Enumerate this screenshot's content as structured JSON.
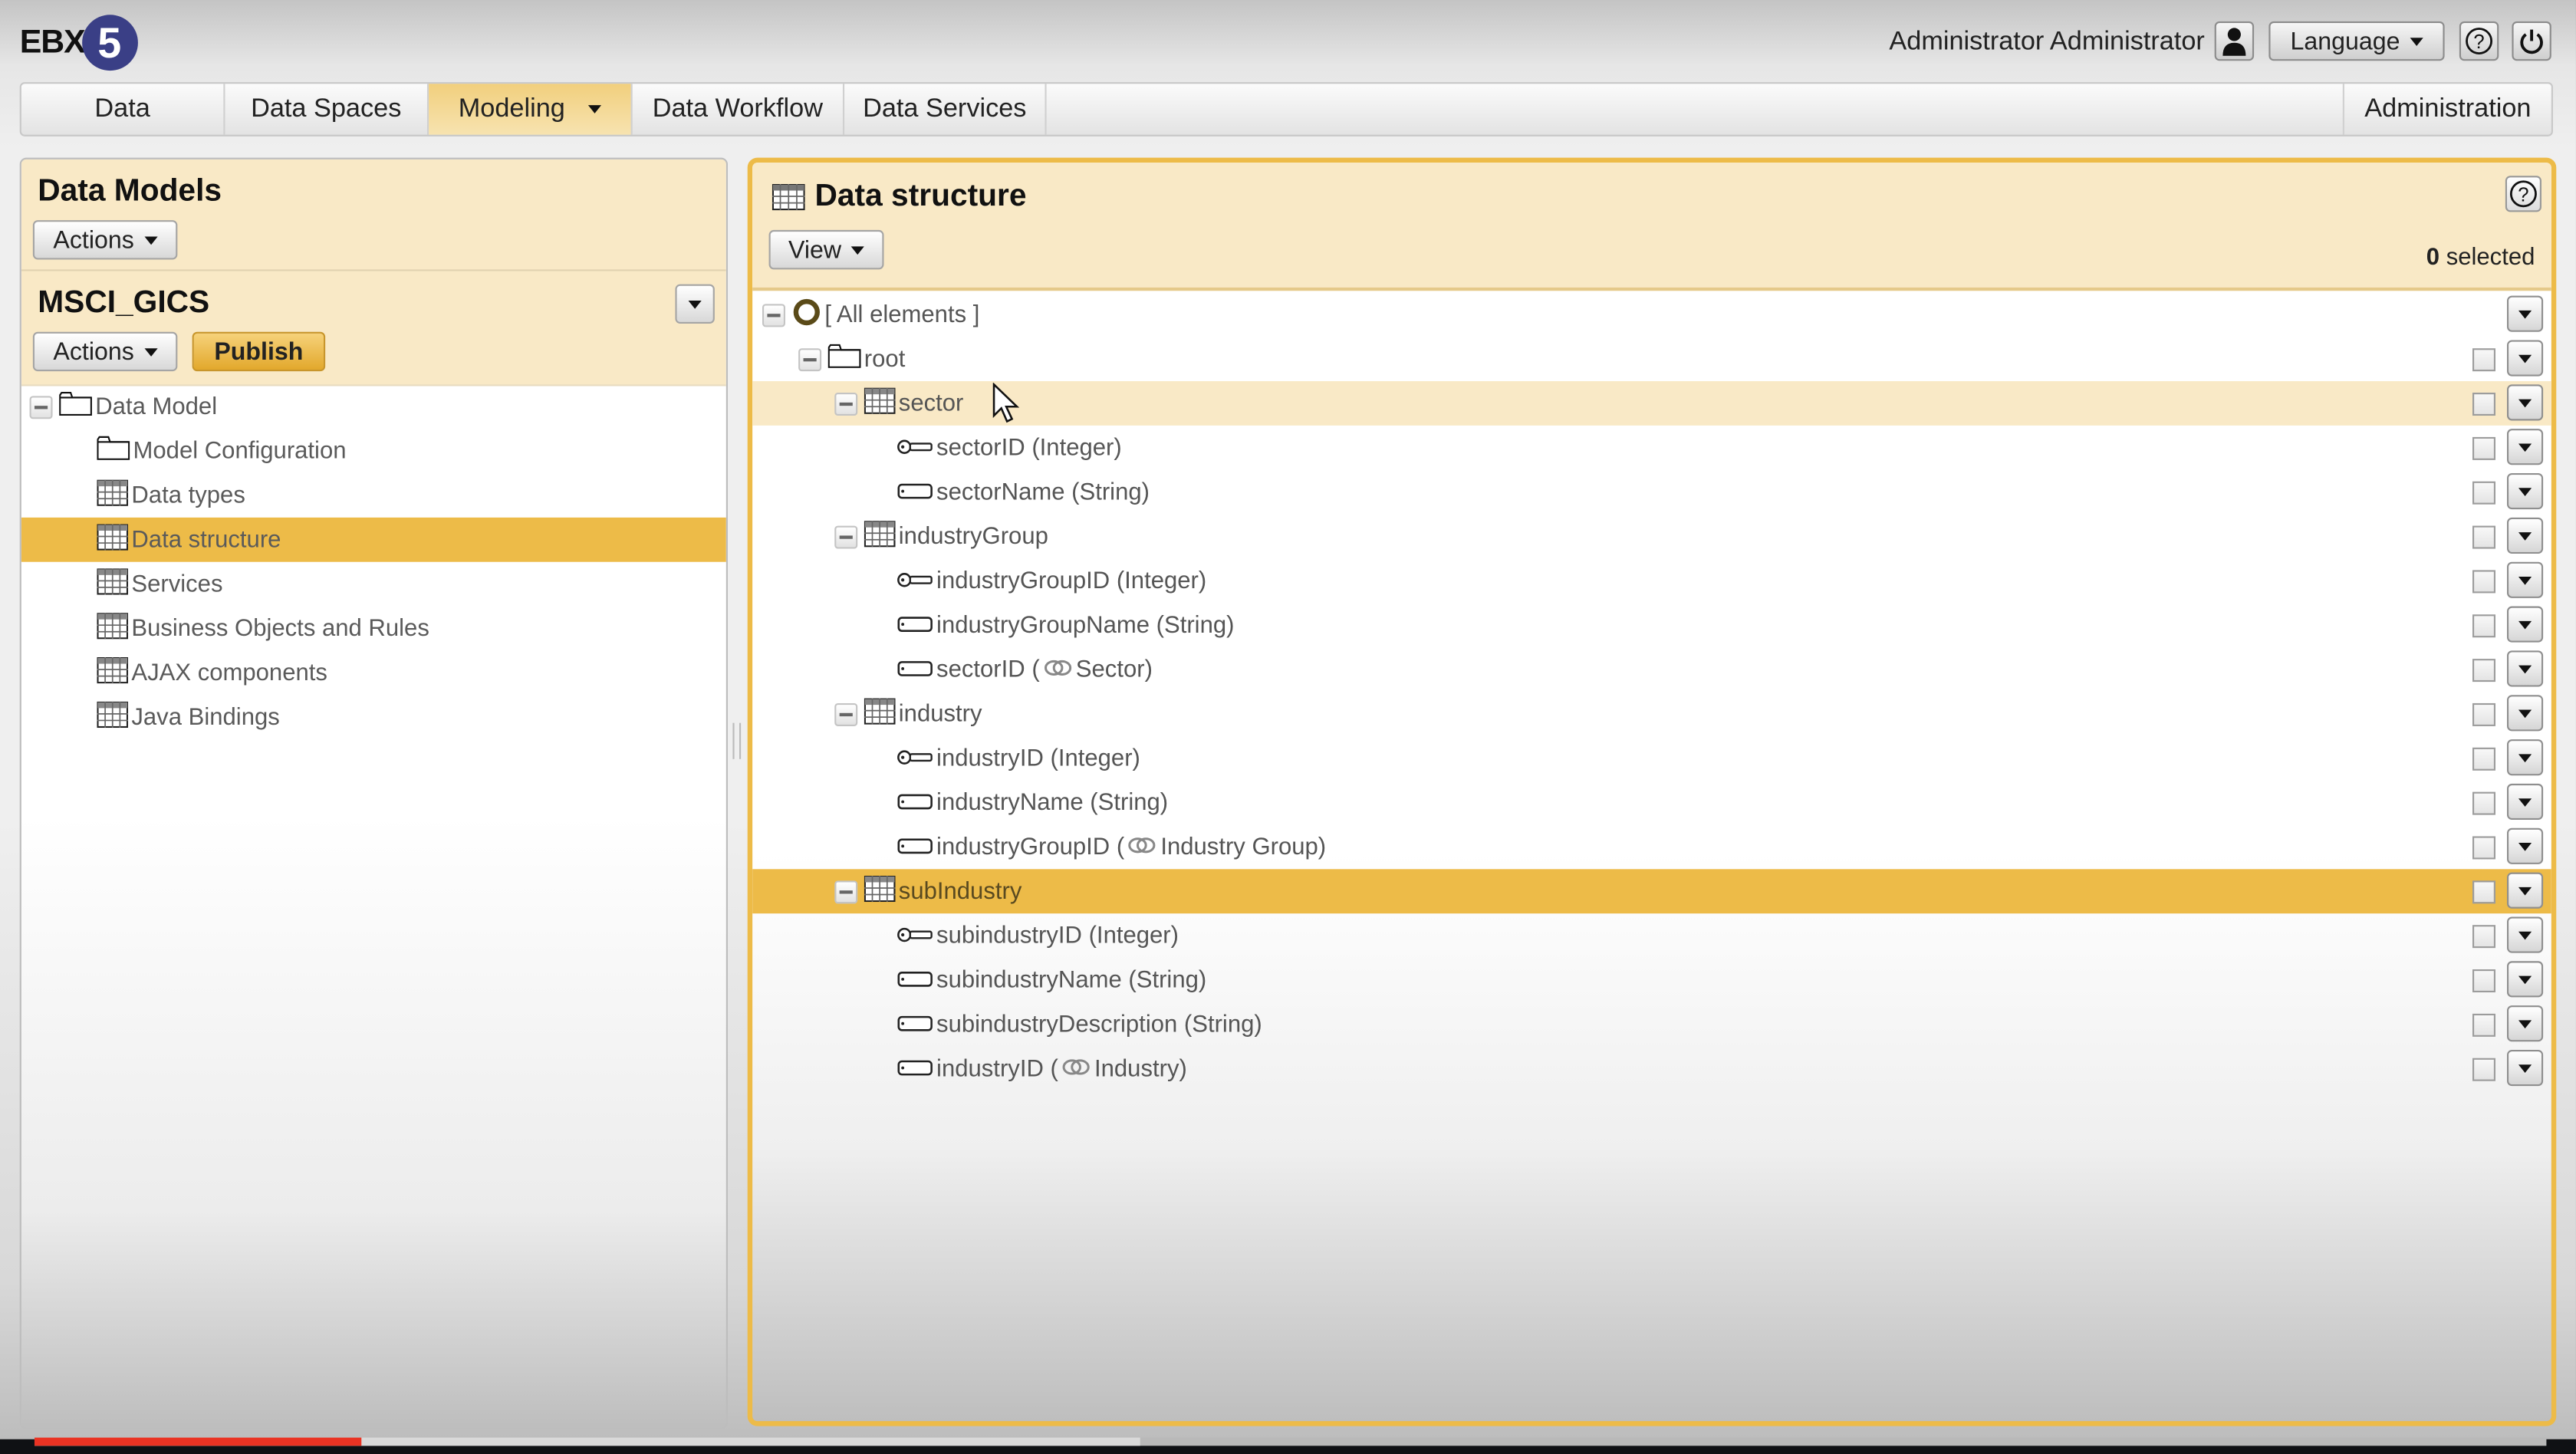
{
  "app": {
    "logo_text": "EBX",
    "logo_number": "5"
  },
  "header": {
    "user_name": "Administrator Administrator",
    "language_label": "Language",
    "icons": [
      "user-icon",
      "help-icon",
      "power-icon"
    ]
  },
  "nav": {
    "tabs": [
      {
        "label": "Data",
        "active": false
      },
      {
        "label": "Data Spaces",
        "active": false
      },
      {
        "label": "Modeling",
        "active": true,
        "has_dropdown": true
      },
      {
        "label": "Data Workflow",
        "active": false
      },
      {
        "label": "Data Services",
        "active": false
      }
    ],
    "right_tab": "Administration"
  },
  "left_panel": {
    "section_title": "Data Models",
    "actions_label": "Actions",
    "model_name": "MSCI_GICS",
    "model_actions_label": "Actions",
    "publish_label": "Publish",
    "tree": [
      {
        "label": "Data Model",
        "icon": "folder-icon",
        "level": 0,
        "expanded": true
      },
      {
        "label": "Model Configuration",
        "icon": "folder-icon",
        "level": 1
      },
      {
        "label": "Data types",
        "icon": "table-icon",
        "level": 1
      },
      {
        "label": "Data structure",
        "icon": "table-icon",
        "level": 1,
        "selected": true
      },
      {
        "label": "Services",
        "icon": "table-icon",
        "level": 1
      },
      {
        "label": "Business Objects and Rules",
        "icon": "table-icon",
        "level": 1
      },
      {
        "label": "AJAX components",
        "icon": "table-icon",
        "level": 1
      },
      {
        "label": "Java Bindings",
        "icon": "table-icon",
        "level": 1
      }
    ]
  },
  "right_panel": {
    "title": "Data structure",
    "view_label": "View",
    "selected_count": "0",
    "selected_suffix": "selected",
    "tree": [
      {
        "label": "[ All elements ]",
        "icon": "circle-icon",
        "level": 0,
        "expandable": true,
        "has_checkbox": false
      },
      {
        "label": "root",
        "icon": "folder-icon",
        "level": 1,
        "expandable": true
      },
      {
        "label": "sector",
        "icon": "table-icon",
        "level": 2,
        "expandable": true,
        "state": "hover"
      },
      {
        "label": "sectorID (Integer)",
        "icon": "key-icon",
        "level": 3
      },
      {
        "label": "sectorName (String)",
        "icon": "field-icon",
        "level": 3
      },
      {
        "label": "industryGroup",
        "icon": "table-icon",
        "level": 2,
        "expandable": true
      },
      {
        "label": "industryGroupID (Integer)",
        "icon": "key-icon",
        "level": 3
      },
      {
        "label": "industryGroupName (String)",
        "icon": "field-icon",
        "level": 3
      },
      {
        "label": "sectorID (",
        "link_target": "Sector)",
        "icon": "field-icon",
        "level": 3,
        "foreign_key": true
      },
      {
        "label": "industry",
        "icon": "table-icon",
        "level": 2,
        "expandable": true
      },
      {
        "label": "industryID (Integer)",
        "icon": "key-icon",
        "level": 3
      },
      {
        "label": "industryName (String)",
        "icon": "field-icon",
        "level": 3
      },
      {
        "label": "industryGroupID (",
        "link_target": "Industry Group)",
        "icon": "field-icon",
        "level": 3,
        "foreign_key": true
      },
      {
        "label": "subIndustry",
        "icon": "table-icon",
        "level": 2,
        "expandable": true,
        "state": "selected"
      },
      {
        "label": "subindustryID (Integer)",
        "icon": "key-icon",
        "level": 3
      },
      {
        "label": "subindustryName (String)",
        "icon": "field-icon",
        "level": 3
      },
      {
        "label": "subindustryDescription (String)",
        "icon": "field-icon",
        "level": 3
      },
      {
        "label": "industryID (",
        "link_target": "Industry)",
        "icon": "field-icon",
        "level": 3,
        "foreign_key": true
      }
    ]
  },
  "video_player": {
    "played_fraction": 0.13,
    "buffered_fraction": 0.44
  },
  "colors": {
    "accent": "#edbb48",
    "panel_header": "#f9e9c6",
    "logo_blue": "#3a3f86",
    "progress_red": "#ea3323"
  }
}
